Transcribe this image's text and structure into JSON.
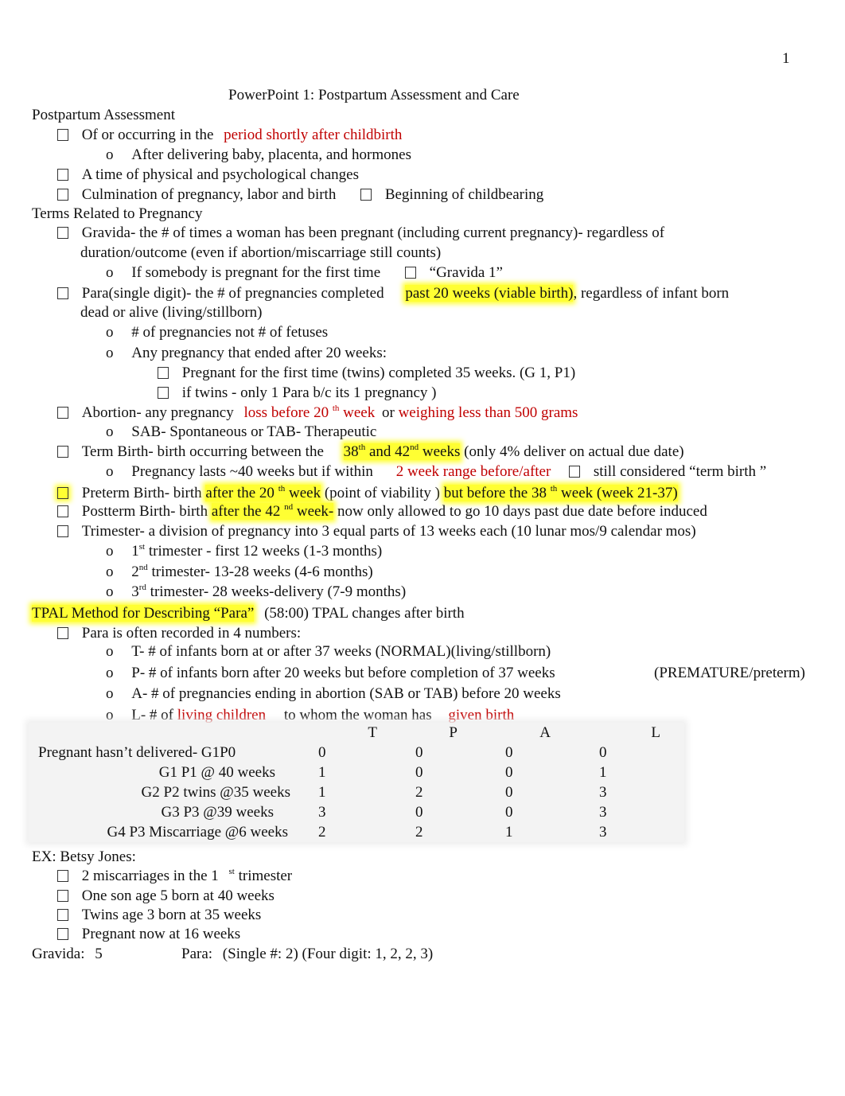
{
  "page_number": "1",
  "title": "PowerPoint 1: Postpartum Assessment and Care",
  "sections": {
    "postpartum": {
      "heading": "Postpartum Assessment",
      "b1_text": "Of or occurring in the",
      "b1_red": "period shortly after childbirth",
      "b1_sub": "After delivering baby, placenta, and hormones",
      "b2": "A time of physical and psychological changes",
      "b3a": "Culmination of pregnancy, labor and birth",
      "b3b": "Beginning of childbearing"
    },
    "terms": {
      "heading": "Terms Related to Pregnancy",
      "gravida_1": "Gravida-   the # of times a woman has been pregnant (including current pregnancy)- regardless of",
      "gravida_2": "duration/outcome (even if abortion/miscarriage still counts)",
      "gravida_sub_a": "If somebody is pregnant for the first time",
      "gravida_sub_b": "“Gravida 1”",
      "para_a": "Para(single digit)-     the # of pregnancies completed",
      "para_hl": "past 20 weeks (viable birth)",
      "para_b": ", regardless of infant born",
      "para_2": "dead or alive (living/stillborn)",
      "para_sub1": "# of pregnancies not # of fetuses",
      "para_sub2": "Any pregnancy that ended after 20 weeks:",
      "para_subsub1": "Pregnant for the first time (twins) completed 35 weeks. (G 1, P1)",
      "para_subsub2": "if twins  - only 1 Para b/c its 1 pregnancy       )",
      "abortion_a": "Abortion-   any pregnancy",
      "abortion_red1": "loss before 20",
      "abortion_sup": "th",
      "abortion_red1b": "week",
      "abortion_or": "or",
      "abortion_red2": "weighing less than 500 grams",
      "abortion_sub": "SAB- Spontaneous or   TAB- Therapeutic",
      "term_a": "Term Birth-    birth occurring between the",
      "term_hl1": "38",
      "term_sup1": "th",
      "term_hl2": "and 42",
      "term_sup2": "nd",
      "term_hl3": "weeks",
      "term_b": "(only 4% deliver on actual due date)",
      "term_sub_a": "Pregnancy lasts ~40 weeks but if within",
      "term_sub_red": "2 week range before/after",
      "term_sub_b": "still considered “term birth   ”",
      "preterm_a": "Preterm Birth-    birth",
      "preterm_hl1": "after the 20",
      "preterm_sup1": "th",
      "preterm_hl1b": "week",
      "preterm_b": "(point of viability    )",
      "preterm_hl2": "but  before the 38",
      "preterm_sup2": "th",
      "preterm_hl2b": "week (week 21-37)",
      "postterm_a": "Postterm Birth-     birth",
      "postterm_hl": "after the 42",
      "postterm_sup": "nd",
      "postterm_hlb": "week-",
      "postterm_b": "now only allowed to go 10 days past due date before induced",
      "trimester": "Trimester-    a division of pregnancy into 3 equal parts of 13 weeks each (10 lunar mos/9 calendar mos)",
      "tri1_n": "1",
      "tri1_sup": "st",
      "tri1": "trimester    - first 12 weeks (1-3 months)",
      "tri2_n": "2",
      "tri2_sup": "nd",
      "tri2": "trimester-    13-28 weeks (4-6 months)",
      "tri3_n": "3",
      "tri3_sup": "rd",
      "tri3": "trimester-    28 weeks-delivery (7-9 months)"
    },
    "tpal": {
      "heading_hl": "TPAL Method for Describing “Para”",
      "heading_rest": "(58:00)  TPAL changes after birth",
      "b1": "Para is often recorded in 4 numbers:",
      "t": "T- # of infants born   at or after 37 weeks      (NORMAL)(living/stillborn)",
      "p": "P- # of infants born   after 20 weeks but before completion of 37 weeks",
      "p_note": "(PREMATURE/preterm)",
      "a": "A- # of pregnancies     ending in abortion (SAB or TAB)   before 20 weeks",
      "l_a": "L- # of",
      "l_red1": "living children",
      "l_b": "to whom the woman has",
      "l_red2": "given birth"
    },
    "table": {
      "headers": [
        "",
        "T",
        "P",
        "A",
        "L"
      ],
      "rows": [
        {
          "label": "Pregnant hasn’t delivered-    G1P0",
          "T": "0",
          "P": "0",
          "A": "0",
          "L": "0"
        },
        {
          "label": "G1 P1 @ 40 weeks",
          "T": "1",
          "P": "0",
          "A": "0",
          "L": "1"
        },
        {
          "label": "G2 P2 twins @35 weeks",
          "T": "1",
          "P": "2",
          "A": "0",
          "L": "3"
        },
        {
          "label": "G3 P3 @39 weeks",
          "T": "3",
          "P": "0",
          "A": "0",
          "L": "3"
        },
        {
          "label": "G4 P3 Miscarriage @6 weeks",
          "T": "2",
          "P": "2",
          "A": "1",
          "L": "3"
        }
      ]
    },
    "example": {
      "heading": "EX: Betsy Jones:",
      "b1a": "2 miscarriages in the 1",
      "b1sup": "st",
      "b1b": "trimester",
      "b2": "One son age 5 born at 40 weeks",
      "b3": "Twins age 3 born at 35 weeks",
      "b4": "Pregnant now at 16 weeks",
      "gravida_label": "Gravida:",
      "gravida_value": "5",
      "para_label": "Para:",
      "para_value": "(Single #: 2) (Four digit: 1, 2, 2, 3)"
    }
  },
  "colors": {
    "accent_red": "#c00000",
    "highlight": "#ffff33"
  }
}
